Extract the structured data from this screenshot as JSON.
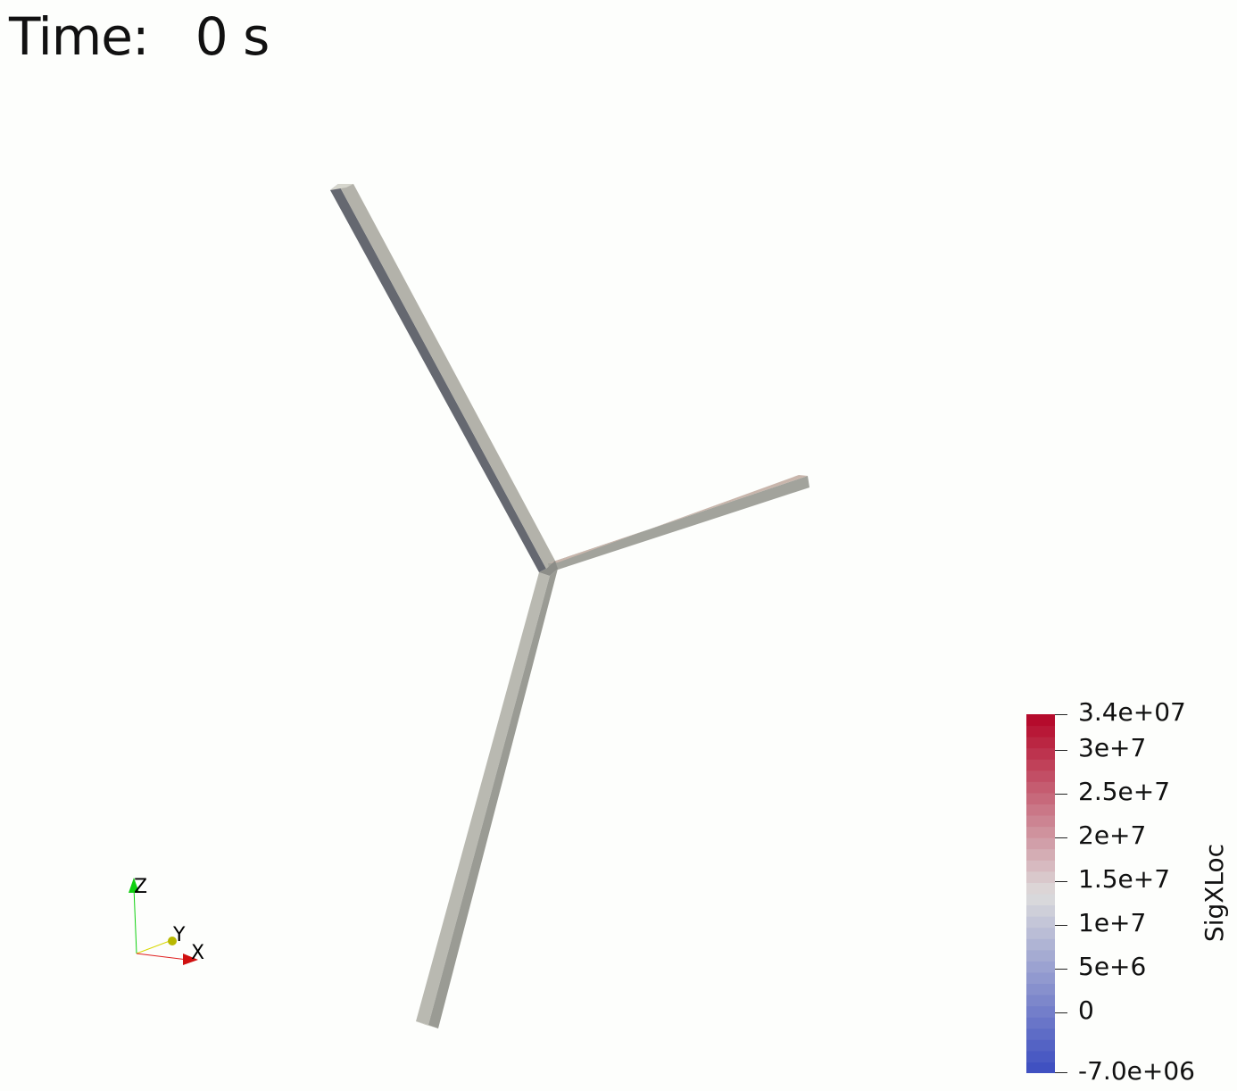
{
  "time_annotation": {
    "label": "Time:",
    "value": "0 s"
  },
  "colorbar": {
    "title": "SigXLoc",
    "range": [
      -7000000,
      34000000
    ],
    "labels": {
      "max": "3.4e+07",
      "t30": "3e+7",
      "t25": "2.5e+7",
      "t20": "2e+7",
      "t15": "1.5e+7",
      "t10": "1e+7",
      "t5": "5e+6",
      "t0": "0",
      "min": "-7.0e+06"
    },
    "colormap": "Cool to Warm",
    "color_low": "#3b4cc0",
    "color_mid": "#dddcdc",
    "color_high": "#b40426"
  },
  "orientation_axes": {
    "x_label": "X",
    "y_label": "Y",
    "z_label": "Z",
    "x_color": "#e02020",
    "y_color": "#d8d800",
    "z_color": "#10d010"
  },
  "model": {
    "surface_color": "#b9b9b1",
    "shadow_color": "#5f6368"
  }
}
